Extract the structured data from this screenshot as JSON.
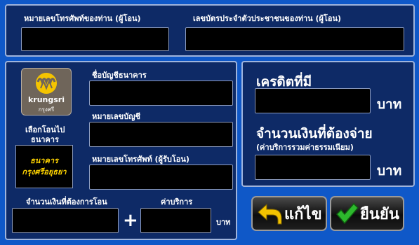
{
  "top": {
    "phone_label": "หมายเลขโทรศัพท์ของท่าน (ผู้โอน)",
    "phone_value": "",
    "id_label": "เลขบัตรประจำตัวประชาชนของท่าน (ผู้โอน)",
    "id_value": ""
  },
  "transfer": {
    "logo_text": "krungsri",
    "logo_subtext": "กรุงศรี",
    "select_bank_label_1": "เลือกโอนไป",
    "select_bank_label_2": "ธนาคาร",
    "bank_name_line1": "ธนาคาร",
    "bank_name_line2": "กรุงศรีอยุธยา",
    "account_name_label": "ชื่อบัญชีธนาคาร",
    "account_number_label": "หมายเลขบัญชี",
    "recipient_phone_label": "หมายเลขโทรศัพท์ (ผู้รับโอน)",
    "amount_label": "จำนวนเงินที่ต้องการโอน",
    "plus_sign": "+",
    "fee_label": "ค่าบริการ",
    "currency": "บาท"
  },
  "summary": {
    "credit_label": "เครดิตที่มี",
    "credit_currency": "บาท",
    "pay_label": "จำนวนเงินที่ต้องจ่าย",
    "pay_sub_label": "(ค่าบริการรวมค่าธรรมเนียม)",
    "pay_currency": "บาท"
  },
  "buttons": {
    "edit_label": "แก้ไข",
    "confirm_label": "ยืนยัน"
  },
  "colors": {
    "background": "#0f58c8",
    "panel": "#0e2a66",
    "bank_name_text": "#ffd400",
    "confirm_check": "#2db82d",
    "edit_arrow": "#f2c200"
  },
  "icons": {
    "edit": "back-arrow-icon",
    "confirm": "checkmark-icon",
    "logo": "krungsri-logo-icon"
  }
}
